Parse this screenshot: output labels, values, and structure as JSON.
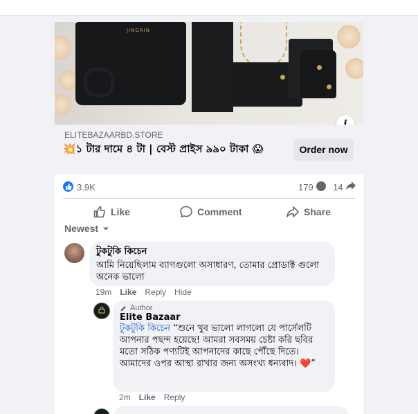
{
  "ad": {
    "image_logo_text": "JINGRIN",
    "domain": "ELITEBAZAARBD.STORE",
    "headline": "💥১ টার দামে ৪ টা | বেস্ট প্রাইস ৯৯০ টাকা 😱",
    "cta_label": "Order now",
    "info_icon_text": "i"
  },
  "stats": {
    "likes": "3.9K",
    "comments": "179",
    "shares": "14"
  },
  "actions": {
    "like": "Like",
    "comment": "Comment",
    "share": "Share"
  },
  "sort_label": "Newest",
  "comments": [
    {
      "author": "টুকটুকি কিচেন",
      "text": "আমি নিয়েছিলাম ব্যাগগুলো অসাধারণ, তোমার প্রোডাক্ট গুলো অনেক ভালো",
      "time": "19m",
      "like": "Like",
      "reply": "Reply",
      "hide": "Hide"
    }
  ],
  "reply": {
    "badge": "Author",
    "author": "Elite Bazaar",
    "mention": "টুকটুকি কিচেন",
    "text": " “শুনে খুব ভালো লাগলো যে পার্সেলটি আপনার পছন্দ হয়েছে! আমরা সবসময় চেষ্টা করি ছবির মতো সঠিক পণ্যটিই আপনাদের কাছে পৌঁছে দিতে। আমাদের ওপর আস্থা রাখার জন্য অসংখ্য ধন্যবাদ। ",
    "heart": "❤️",
    "closing_quote": "”",
    "time": "2m",
    "like": "Like",
    "reply": "Reply"
  },
  "colors": {
    "accent": "#1877f2",
    "mention": "#1e5ec6",
    "muted": "#65676b",
    "bubble": "#f0f2f5"
  }
}
